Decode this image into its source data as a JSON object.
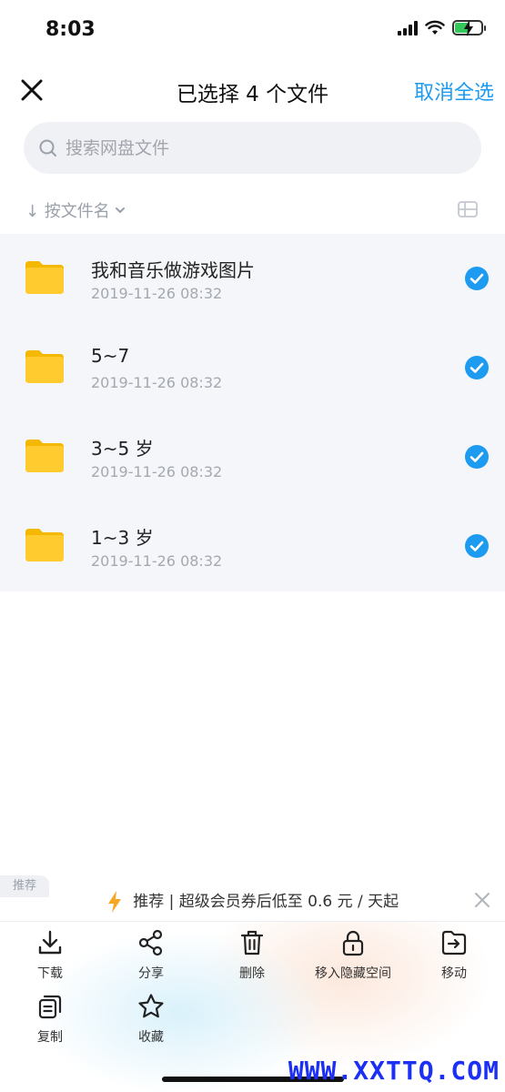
{
  "status": {
    "time": "8:03"
  },
  "header": {
    "title": "已选择 4 个文件",
    "cancel_all": "取消全选"
  },
  "search": {
    "placeholder": "搜索网盘文件"
  },
  "sort": {
    "label": "↓ 按文件名"
  },
  "files": [
    {
      "name": "我和音乐做游戏图片",
      "date": "2019-11-26 08:32",
      "selected": true
    },
    {
      "name": "5~7",
      "date": "2019-11-26 08:32",
      "selected": true
    },
    {
      "name": "3~5 岁",
      "date": "2019-11-26 08:32",
      "selected": true
    },
    {
      "name": "1~3 岁",
      "date": "2019-11-26 08:32",
      "selected": true
    }
  ],
  "promo": {
    "tag": "推荐",
    "text": "推荐 | 超级会员券后低至 0.6 元 / 天起"
  },
  "toolbar": {
    "download": "下载",
    "share": "分享",
    "delete": "删除",
    "hide": "移入隐藏空间",
    "move": "移动",
    "copy": "复制",
    "favorite": "收藏"
  },
  "watermark": "WWW.XXTTQ.COM",
  "colors": {
    "accent": "#1c9bf0",
    "folder": "#ffcb2f",
    "check": "#1c9bf0"
  }
}
